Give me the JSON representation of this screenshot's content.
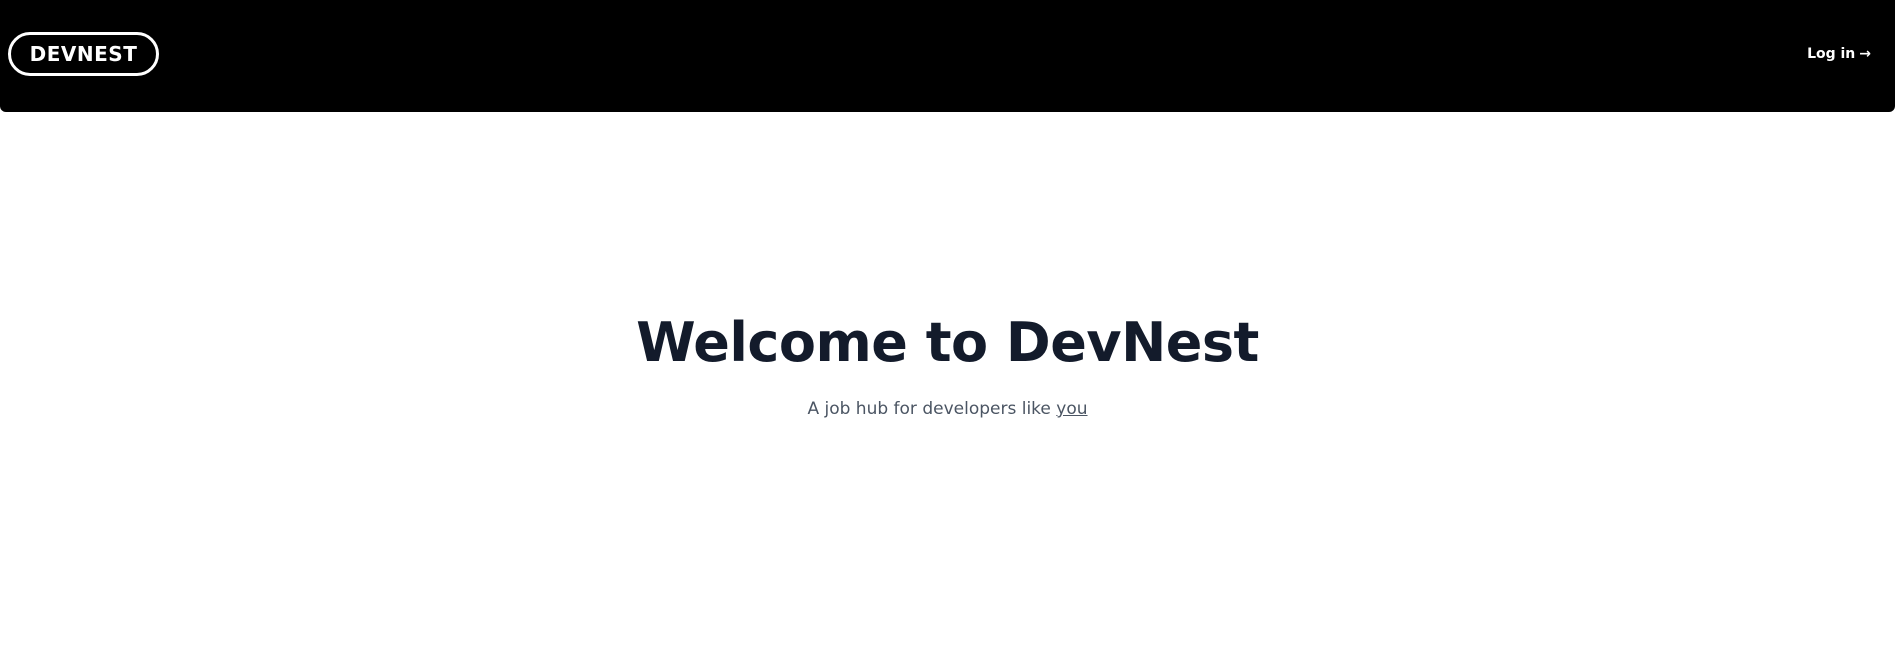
{
  "header": {
    "logo_text": "DEVNEST",
    "login_label": "Log in",
    "login_arrow": "→"
  },
  "hero": {
    "title": "Welcome to DevNest",
    "subtitle_prefix": "A job hub for developers like ",
    "subtitle_link": "you"
  },
  "colors": {
    "header_bg": "#000000",
    "title": "#131b2b",
    "subtitle": "#4b5563"
  }
}
